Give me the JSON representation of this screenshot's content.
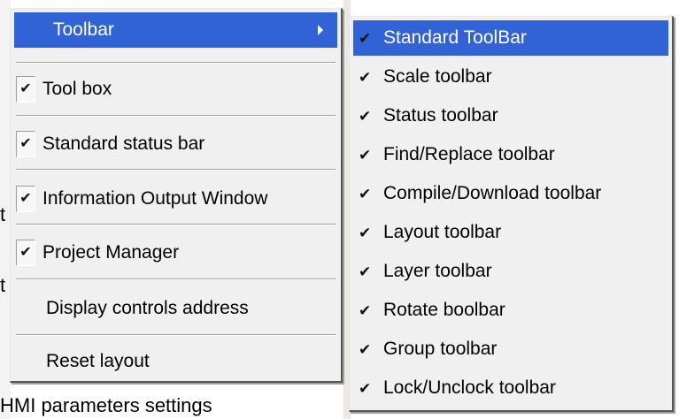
{
  "background": {
    "bottom_label": "HMI parameters settings",
    "fragment_a": "t",
    "fragment_b": "t"
  },
  "main_menu": {
    "items": [
      {
        "label": "Toolbar",
        "checked": false,
        "has_submenu": true,
        "highlighted": true
      },
      {
        "label": "Tool box",
        "checked": true
      },
      {
        "label": "Standard status bar",
        "checked": true
      },
      {
        "label": "Information Output Window",
        "checked": true
      },
      {
        "label": "Project Manager",
        "checked": true
      },
      {
        "label": "Display controls address",
        "checked": false
      },
      {
        "label": "Reset layout",
        "checked": false
      }
    ],
    "check_glyph": "✔",
    "submenu_arrow_icon": "triangle-right-icon"
  },
  "submenu": {
    "items": [
      {
        "label": "Standard ToolBar",
        "checked": true,
        "highlighted": true
      },
      {
        "label": "Scale toolbar",
        "checked": true
      },
      {
        "label": "Status toolbar",
        "checked": true
      },
      {
        "label": "Find/Replace toolbar",
        "checked": true
      },
      {
        "label": "Compile/Download toolbar",
        "checked": true
      },
      {
        "label": "Layout toolbar",
        "checked": true
      },
      {
        "label": "Layer toolbar",
        "checked": true
      },
      {
        "label": "Rotate boolbar",
        "checked": true
      },
      {
        "label": "Group toolbar",
        "checked": true
      },
      {
        "label": "Lock/Unclock toolbar",
        "checked": true
      }
    ],
    "check_glyph": "✔"
  },
  "colors": {
    "menu_bg": "#f0f0f0",
    "highlight": "#3163d6",
    "highlight_text": "#ffffff"
  }
}
